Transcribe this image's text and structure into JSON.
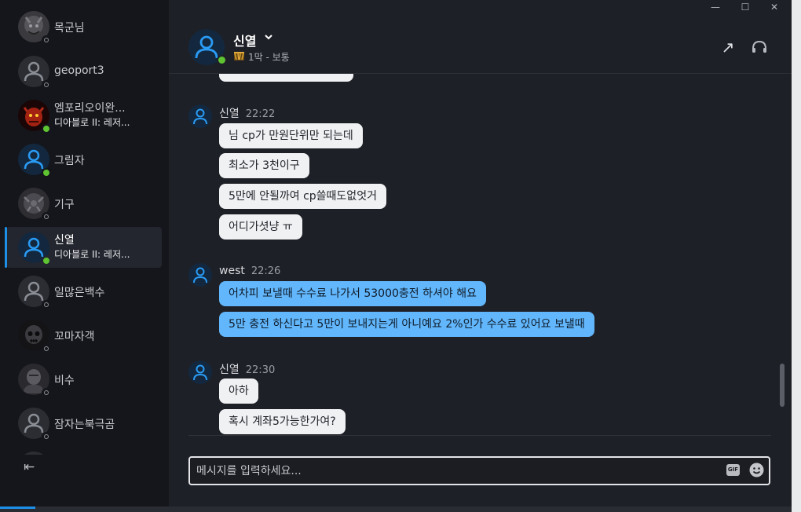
{
  "sidebar": {
    "friends": [
      {
        "name": "목군님",
        "subtitle": "",
        "status": "offline",
        "avatar": "dark-demon-avatar",
        "active": false
      },
      {
        "name": "geoport3",
        "subtitle": "",
        "status": "offline",
        "avatar": "default-user-avatar",
        "active": false
      },
      {
        "name": "엠포리오이완...",
        "subtitle": "디아블로 II: 레저...",
        "status": "online",
        "avatar": "red-diablo-avatar",
        "active": false
      },
      {
        "name": "그림자",
        "subtitle": "",
        "status": "online",
        "avatar": "blue-user-avatar",
        "active": false
      },
      {
        "name": "기구",
        "subtitle": "",
        "status": "offline",
        "avatar": "dark-demon-avatar",
        "active": false
      },
      {
        "name": "신열",
        "subtitle": "디아블로 II: 레저...",
        "status": "online",
        "avatar": "blue-user-avatar",
        "active": true
      },
      {
        "name": "일많은백수",
        "subtitle": "",
        "status": "offline",
        "avatar": "default-user-avatar",
        "active": false
      },
      {
        "name": "꼬마자객",
        "subtitle": "",
        "status": "offline",
        "avatar": "skull-avatar",
        "active": false
      },
      {
        "name": "비수",
        "subtitle": "",
        "status": "offline",
        "avatar": "dark-warrior-avatar",
        "active": false
      },
      {
        "name": "잠자는북극곰",
        "subtitle": "",
        "status": "offline",
        "avatar": "default-user-avatar",
        "active": false
      }
    ],
    "collapse_icon": "⇤"
  },
  "window_controls": {
    "minimize": "—",
    "maximize": "☐",
    "close": "✕"
  },
  "chat_header": {
    "name": "신열",
    "chevron": "⌄",
    "game_icon": "diablo-ii-game-icon",
    "subtitle": "1막 - 보통",
    "expand_icon": "↗",
    "call_icon": "headset-icon"
  },
  "messages": {
    "groups": [
      {
        "author": "신열",
        "time": "22:22",
        "kind": "recv",
        "lines": [
          "님 cp가 만원단위만 되는데",
          "최소가 3천이구",
          "5만에 안될까여 cp쓸때도없엇거",
          "어디가셧냥 ㅠ"
        ]
      },
      {
        "author": "west",
        "time": "22:26",
        "kind": "sent",
        "lines": [
          "어차피 보낼때 수수료 나가서 53000충전 하셔야 해요",
          "5만 충전 하신다고 5만이 보내지는게 아니예요 2%인가 수수료 있어요 보낼때"
        ]
      },
      {
        "author": "신열",
        "time": "22:30",
        "kind": "recv",
        "lines": [
          "아하",
          "혹시 계좌5가능한가여?"
        ]
      }
    ]
  },
  "composer": {
    "placeholder": "메시지를 입력하세요...",
    "gif_label": "GIF",
    "emoji_icon": "smiley-icon"
  },
  "colors": {
    "accent": "#1e8fe6",
    "online": "#5fc432",
    "sent_bubble": "#62b6fb",
    "recv_bubble": "#f0f1f3"
  }
}
